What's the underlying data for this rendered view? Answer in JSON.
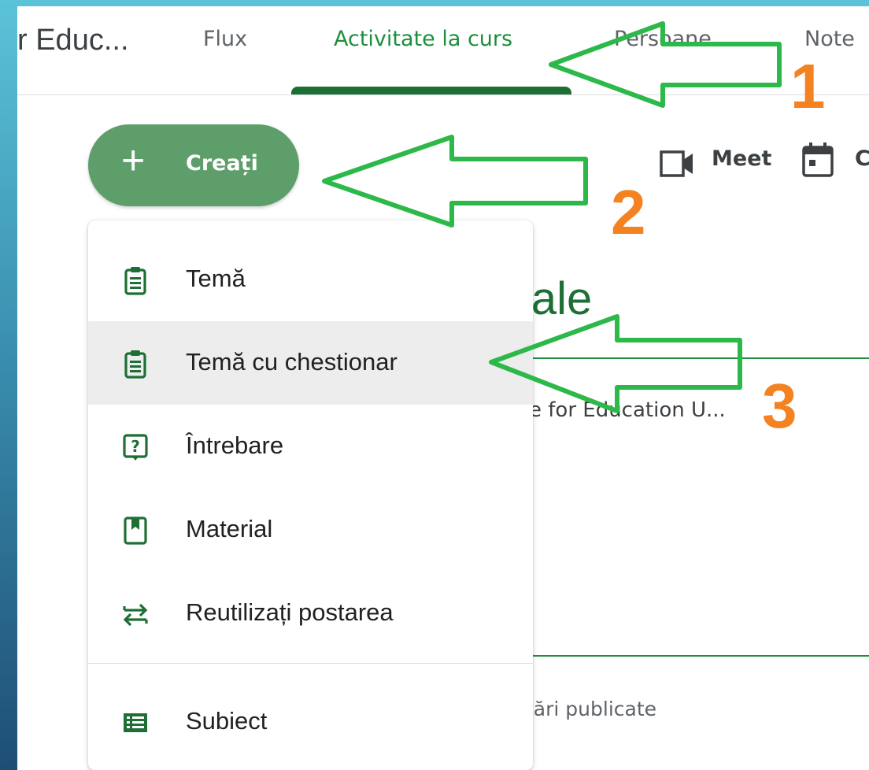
{
  "header": {
    "class_title": "r Educ...",
    "tabs": [
      {
        "label": "Flux"
      },
      {
        "label": "Activitate la curs"
      },
      {
        "label": "Persoane"
      },
      {
        "label": "Note"
      }
    ]
  },
  "toolbar": {
    "create_label": "Creați",
    "meet_label": "Meet",
    "calendar_label": "C"
  },
  "background": {
    "heading_fragment": "iale",
    "drive_fragment": "e for Education U...",
    "posts_fragment": "tări publicate"
  },
  "create_menu": {
    "items": [
      {
        "label": "Temă",
        "icon": "assignment-icon"
      },
      {
        "label": "Temă cu chestionar",
        "icon": "quiz-assignment-icon"
      },
      {
        "label": "Întrebare",
        "icon": "question-icon"
      },
      {
        "label": "Material",
        "icon": "material-icon"
      },
      {
        "label": "Reutilizați postarea",
        "icon": "reuse-icon"
      },
      {
        "label": "Subiect",
        "icon": "topic-icon"
      }
    ],
    "highlighted_index": 1
  },
  "annotations": {
    "step_numbers": [
      "1",
      "2",
      "3"
    ]
  },
  "colors": {
    "accent_green": "#1e8e3e",
    "create_button": "#5e9e6a",
    "arrow_green": "#2db84a",
    "step_number_orange": "#f58220"
  }
}
